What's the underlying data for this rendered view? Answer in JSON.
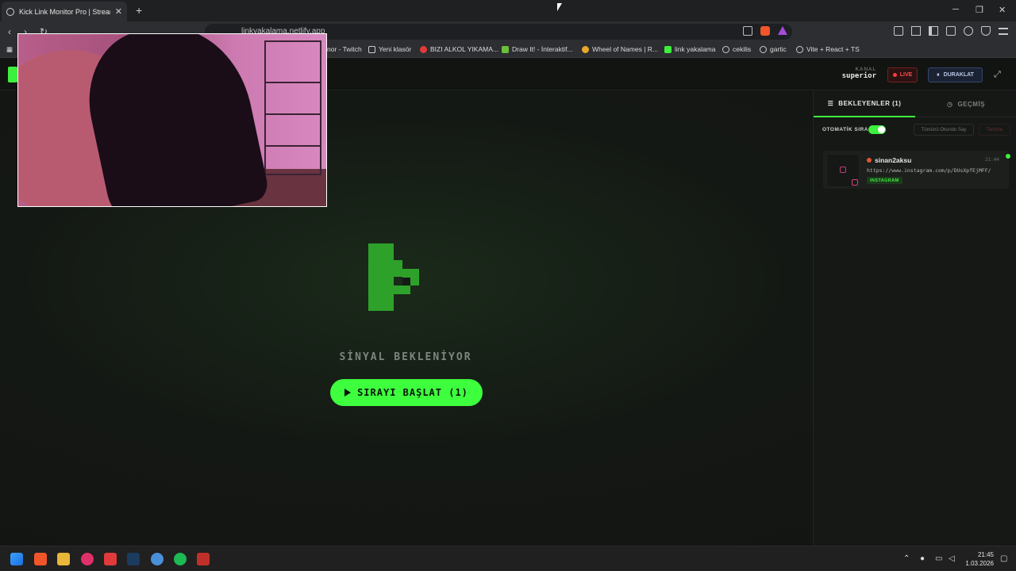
{
  "browser": {
    "tab_title": "Kick Link Monitor Pro | Stream D",
    "url": "linkyakalama.netlify.app",
    "bookmarks": [
      {
        "label": "nor - Twitch",
        "color": "#9146ff"
      },
      {
        "label": "Yeni klasör",
        "color": "#cccccc"
      },
      {
        "label": "BIZI ALKOL YIKAMA...",
        "color": "#e03a3a"
      },
      {
        "label": "Draw It! - İnteraktif...",
        "color": "#6bbf3a"
      },
      {
        "label": "Wheel of Names | R...",
        "color": "#e8a82a"
      },
      {
        "label": "link yakalama",
        "color": "#3df03d"
      },
      {
        "label": "cekilis",
        "color": "#cccccc"
      },
      {
        "label": "gartic",
        "color": "#cccccc"
      },
      {
        "label": "Vite + React + TS",
        "color": "#cccccc"
      }
    ]
  },
  "header": {
    "kanal_label": "KANAL",
    "kanal_value": "superior",
    "live_label": "LIVE",
    "pause_label": "DURAKLAT"
  },
  "main": {
    "status_text": "SİNYAL BEKLENİYOR",
    "start_button": "SIRAYI BAŞLAT (1)"
  },
  "panel": {
    "tab_waiting": "BEKLEYENLER (1)",
    "tab_history": "GEÇMİŞ",
    "auto_queue_label": "OTOMATİK SIRA",
    "mark_all_label": "Tümünü Okundu Say",
    "clear_label": "Temizle",
    "items": [
      {
        "user": "sinan2aksu",
        "time": "21:44",
        "link": "https://www.instagram.com/p/DUsXpfEjMFF/",
        "platform": "INSTAGRAM"
      }
    ]
  },
  "taskbar": {
    "time": "21:45",
    "date": "1.03.2026"
  },
  "colors": {
    "accent": "#3df03d",
    "live": "#ff4b4b"
  }
}
